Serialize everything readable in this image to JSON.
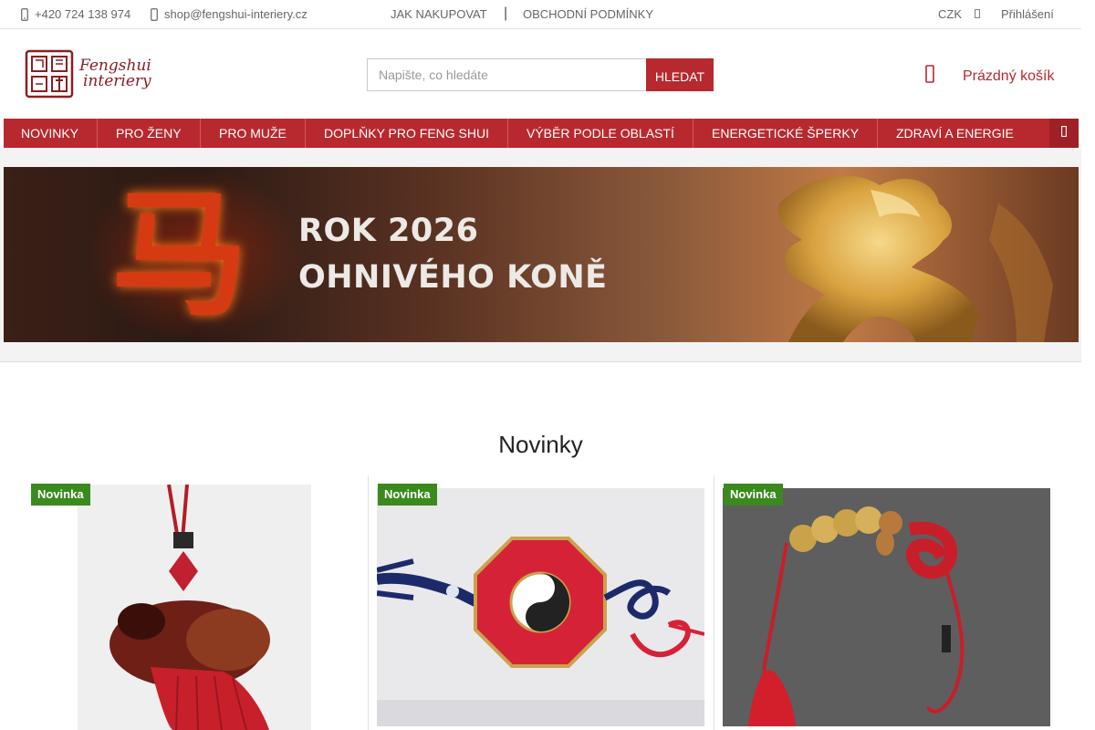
{
  "topbar": {
    "phone": "+420 724 138 974",
    "email": "shop@fengshui-interiery.cz",
    "links": [
      "JAK NAKUPOVAT",
      "OBCHODNÍ PODMÍNKY"
    ],
    "currency": "CZK",
    "login": "Přihlášení"
  },
  "header": {
    "logo_line1": "Fengshui",
    "logo_line2": "interiery",
    "search_placeholder": "Napište, co hledáte",
    "search_button": "HLEDAT",
    "cart_label": "Prázdný košík"
  },
  "nav": {
    "items": [
      "NOVINKY",
      "PRO ŽENY",
      "PRO MUŽE",
      "DOPLŇKY PRO FENG SHUI",
      "VÝBĚR PODLE OBLASTÍ",
      "ENERGETICKÉ ŠPERKY",
      "ZDRAVÍ A ENERGIE"
    ]
  },
  "banner": {
    "hanzi": "马",
    "line1": "ROK 2026",
    "line2": "OHNIVÉHO KONĚ"
  },
  "section": {
    "title": "Novinky"
  },
  "products": [
    {
      "badge": "Novinka"
    },
    {
      "badge": "Novinka"
    },
    {
      "badge": "Novinka"
    }
  ],
  "colors": {
    "accent": "#b8292f",
    "badge": "#3a8a1e"
  }
}
